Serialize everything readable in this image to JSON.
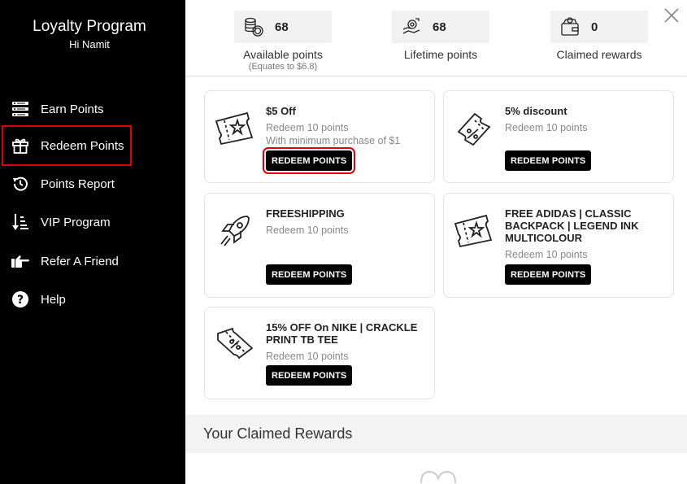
{
  "sidebar": {
    "title": "Loyalty Program",
    "greeting": "Hi Namit",
    "items": [
      {
        "label": "Earn Points",
        "icon": "earn-points-icon"
      },
      {
        "label": "Redeem Points",
        "icon": "gift-icon",
        "active": true
      },
      {
        "label": "Points Report",
        "icon": "history-icon"
      },
      {
        "label": "VIP Program",
        "icon": "sort-order-icon"
      },
      {
        "label": "Refer A Friend",
        "icon": "pointing-hand-icon"
      },
      {
        "label": "Help",
        "icon": "question-circle-icon"
      }
    ]
  },
  "stats": {
    "available": {
      "value": "68",
      "label": "Available points",
      "sub": "(Equates to $6.8)",
      "icon": "coins-icon"
    },
    "lifetime": {
      "value": "68",
      "label": "Lifetime points",
      "icon": "hand-coin-icon"
    },
    "claimed": {
      "value": "0",
      "label": "Claimed rewards",
      "icon": "wallet-icon"
    }
  },
  "rewards": [
    {
      "title": "$5 Off",
      "desc": [
        "Redeem 10 points",
        "With minimum purchase of $1"
      ],
      "button": "REDEEM POINTS",
      "icon": "ticket-star-icon",
      "highlighted": true
    },
    {
      "title": "5% discount",
      "desc": [
        "Redeem 10 points"
      ],
      "button": "REDEEM POINTS",
      "icon": "percent-coupon-icon"
    },
    {
      "title": "FREESHIPPING",
      "desc": [
        "Redeem 10 points"
      ],
      "button": "REDEEM POINTS",
      "icon": "rocket-icon"
    },
    {
      "title": "FREE ADIDAS | CLASSIC BACKPACK | LEGEND INK MULTICOLOUR",
      "desc": [
        "Redeem 10 points"
      ],
      "button": "REDEEM POINTS",
      "icon": "ticket-star-icon"
    },
    {
      "title": "15% OFF On NIKE | CRACKLE PRINT TB TEE",
      "desc": [
        "Redeem 10 points"
      ],
      "button": "REDEEM POINTS",
      "icon": "percent-coupon-icon"
    }
  ],
  "claimed_section": {
    "title": "Your Claimed Rewards"
  },
  "colors": {
    "sidebar_bg": "#000000",
    "highlight": "#e10000",
    "button_bg": "#000000"
  }
}
